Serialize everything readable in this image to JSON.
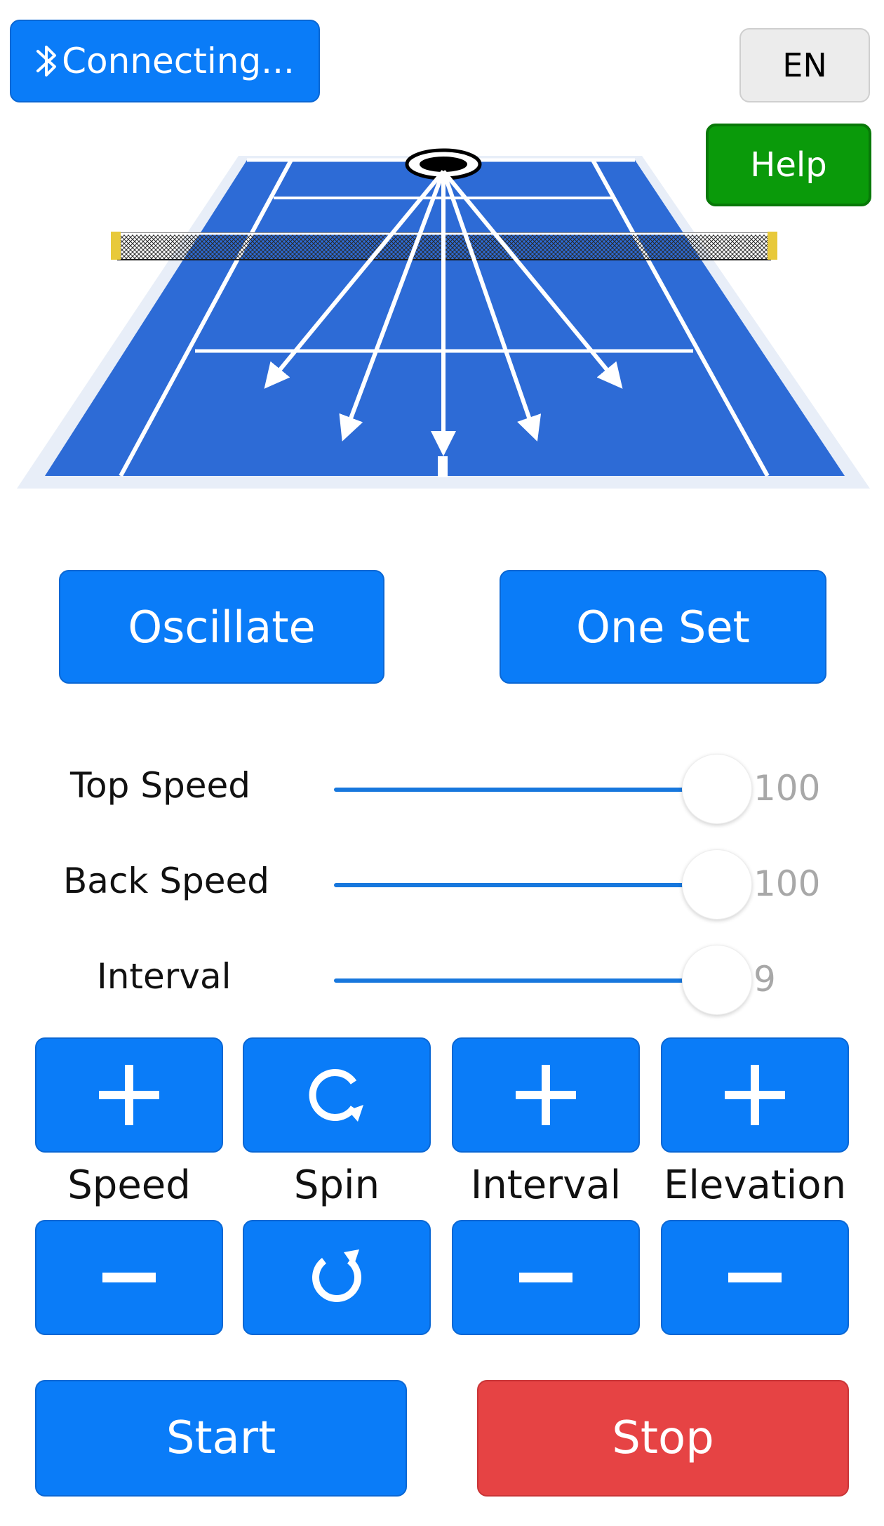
{
  "header": {
    "connect_label": "Connecting...",
    "language_label": "EN",
    "help_label": "Help"
  },
  "modes": {
    "oscillate_label": "Oscillate",
    "one_set_label": "One Set"
  },
  "sliders": [
    {
      "label": "Top Speed",
      "value": "100",
      "fraction": 1.0
    },
    {
      "label": "Back Speed",
      "value": "100",
      "fraction": 1.0
    },
    {
      "label": "Interval",
      "value": "9",
      "fraction": 1.0
    }
  ],
  "controls": {
    "speed_label": "Speed",
    "spin_label": "Spin",
    "interval_label": "Interval",
    "elevation_label": "Elevation",
    "icons": {
      "speed_up": "plus-icon",
      "speed_down": "minus-icon",
      "spin_up": "rotate-clockwise-icon",
      "spin_down": "rotate-counterclockwise-icon",
      "interval_up": "plus-icon",
      "interval_down": "minus-icon",
      "elevation_up": "plus-icon",
      "elevation_down": "minus-icon"
    }
  },
  "actions": {
    "start_label": "Start",
    "stop_label": "Stop"
  },
  "colors": {
    "primary_blue": "#0a7cf8",
    "stop_red": "#e64344",
    "help_green": "#0a9a0a",
    "court_blue": "#2d6bd6"
  }
}
